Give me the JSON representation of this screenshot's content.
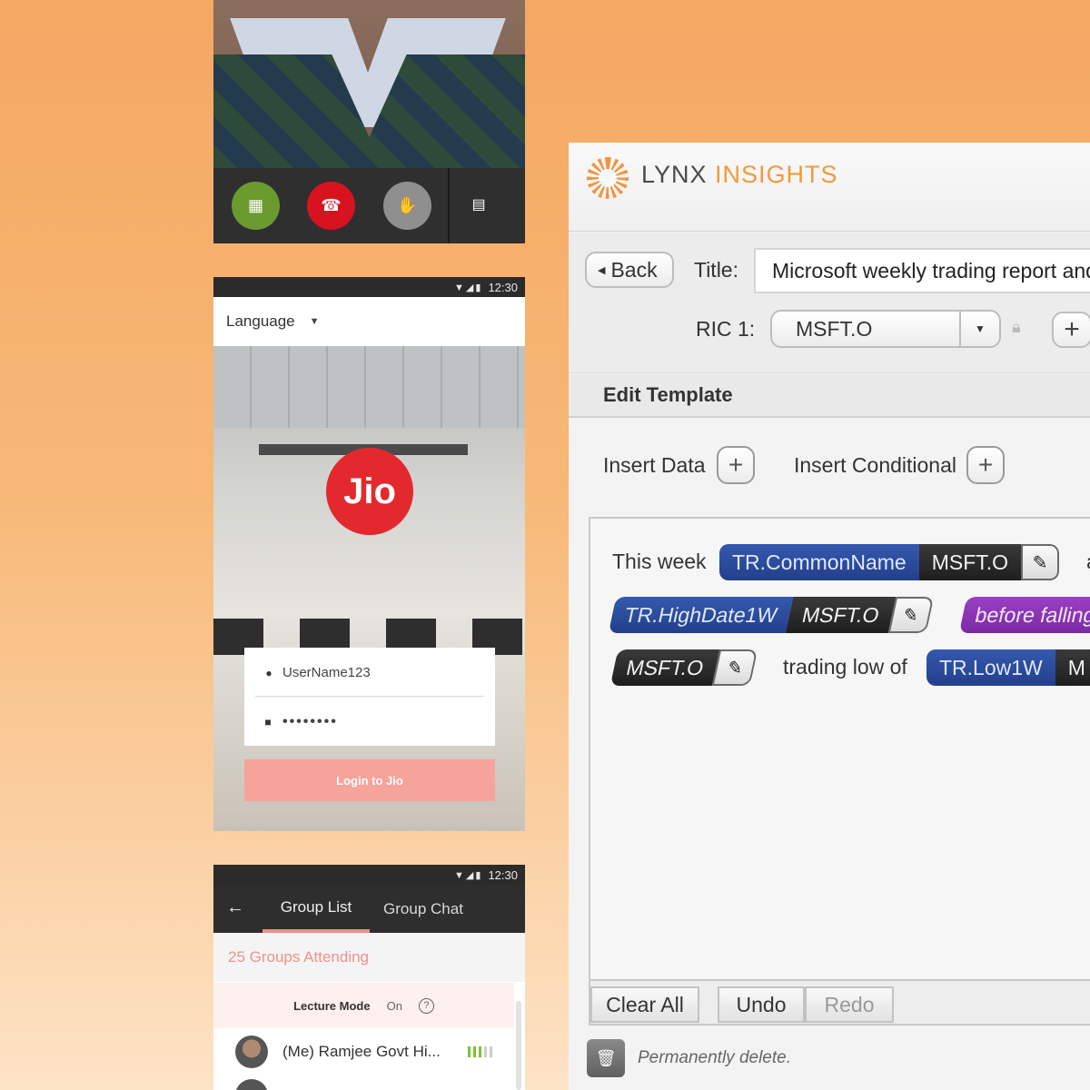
{
  "video_call": {
    "controls": {
      "layout_icon": "grid-layout-icon",
      "hangup_icon": "phone-hangup-icon",
      "raise_hand_icon": "raise-hand-icon",
      "chat_icon": "chat-bubble-icon"
    }
  },
  "login_screen": {
    "status_bar": {
      "time": "12:30"
    },
    "language_label": "Language",
    "logo_text": "Jio",
    "username_value": "UserName123",
    "password_value": "••••••••",
    "login_button": "Login to Jio",
    "colors": {
      "logo": "#e3292d",
      "button": "#f5a39b"
    }
  },
  "group_screen": {
    "status_bar": {
      "time": "12:30"
    },
    "tabs": [
      "Group List",
      "Group Chat"
    ],
    "active_tab": "Group List",
    "groups_attending": "25 Groups Attending",
    "lecture_mode": {
      "label": "Lecture Mode",
      "state": "On"
    },
    "members": [
      {
        "name": "(Me) Ramjee Govt Hi...",
        "signal_bars_on": 3,
        "signal_bars_total": 5
      }
    ]
  },
  "lynx": {
    "brand": {
      "part1": "LYNX",
      "part2": "INSIGHTS"
    },
    "back_label": "Back",
    "title_label": "Title:",
    "title_value": "Microsoft weekly trading report and",
    "ric_label": "RIC 1:",
    "ric_value": "MSFT.O",
    "edit_template": "Edit Template",
    "insert_data": "Insert Data",
    "insert_conditional": "Insert Conditional",
    "editor": {
      "line1": {
        "text": "This week",
        "field": "TR.CommonName",
        "ric": "MSFT.O",
        "trail": "a"
      },
      "line2": {
        "field": "TR.HighDate1W",
        "ric": "MSFT.O",
        "conditional": "before falling"
      },
      "line3": {
        "ric": "MSFT.O",
        "text": "trading low of",
        "field": "TR.Low1W",
        "trail": "M"
      }
    },
    "footer": {
      "clear": "Clear All",
      "undo": "Undo",
      "redo": "Redo"
    },
    "delete_label": "Permanently delete.",
    "colors": {
      "accent": "#f39a3a",
      "field_chip": "#2c4a9a",
      "ric_chip": "#2a2a2a",
      "conditional_chip": "#8a35b5"
    }
  }
}
